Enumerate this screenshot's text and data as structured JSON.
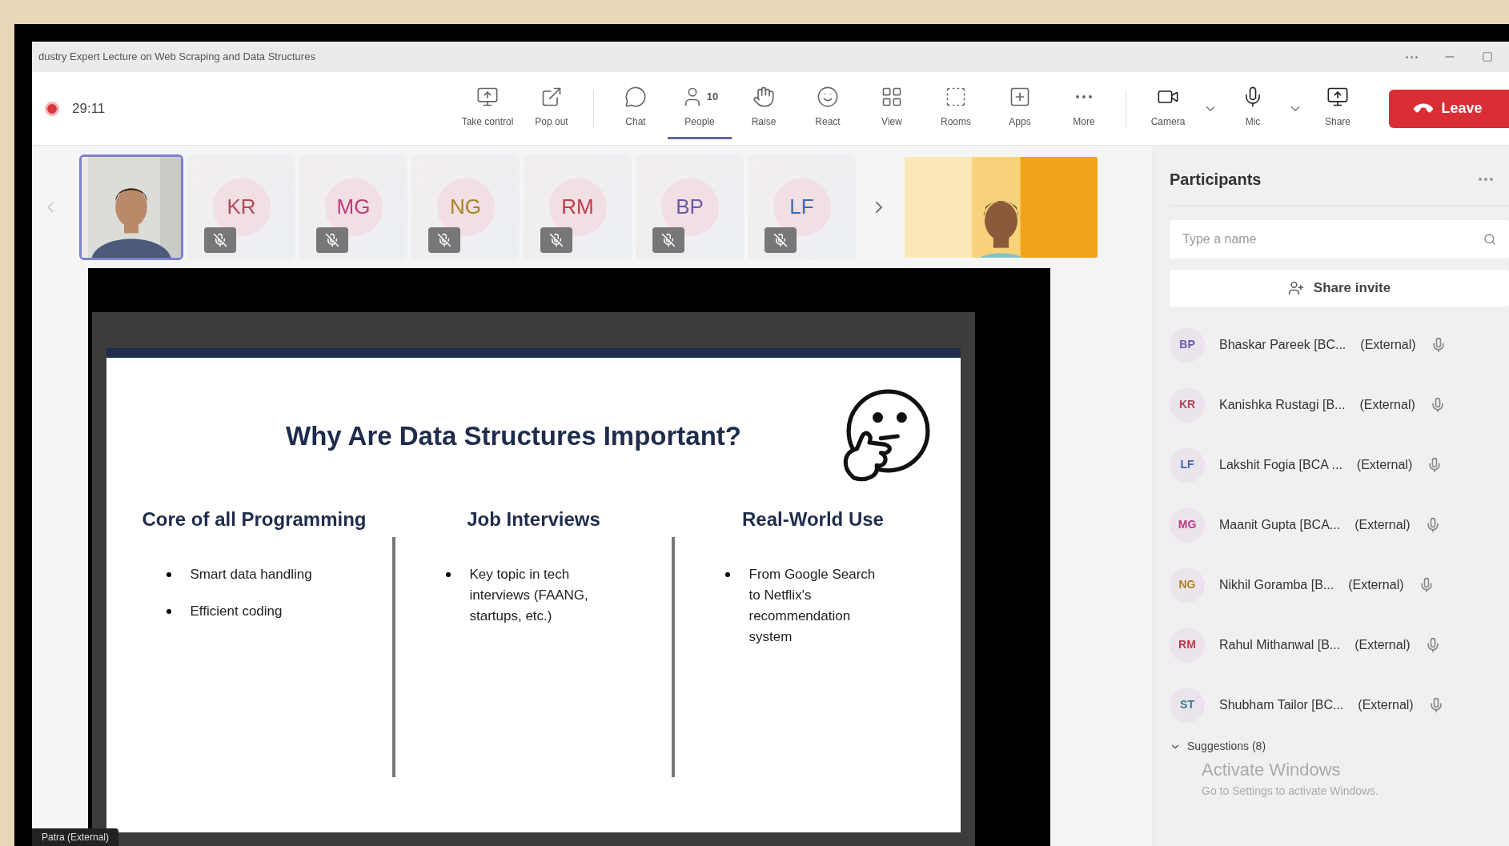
{
  "window": {
    "title": "dustry Expert Lecture on Web Scraping and Data Structures"
  },
  "toolbar": {
    "recording": true,
    "timer": "29:11",
    "items": [
      {
        "kind": "take-control",
        "label": "Take control",
        "selected": false
      },
      {
        "kind": "pop-out",
        "label": "Pop out",
        "selected": false
      },
      {
        "kind": "divider"
      },
      {
        "kind": "chat",
        "label": "Chat",
        "selected": false
      },
      {
        "kind": "people",
        "label": "People",
        "count": "10",
        "selected": true
      },
      {
        "kind": "raise",
        "label": "Raise",
        "selected": false
      },
      {
        "kind": "react",
        "label": "React",
        "selected": false
      },
      {
        "kind": "view",
        "label": "View",
        "selected": false
      },
      {
        "kind": "rooms",
        "label": "Rooms",
        "selected": false
      },
      {
        "kind": "apps",
        "label": "Apps",
        "selected": false
      },
      {
        "kind": "more",
        "label": "More",
        "selected": false
      },
      {
        "kind": "divider"
      },
      {
        "kind": "camera",
        "label": "Camera",
        "selected": false
      },
      {
        "kind": "mic",
        "label": "Mic",
        "selected": false
      },
      {
        "kind": "share",
        "label": "Share",
        "selected": false
      }
    ],
    "leave_button": "Leave"
  },
  "thumbnails": [
    {
      "kind": "video",
      "selected": true
    },
    {
      "kind": "avatar",
      "initials": "KR",
      "color": "#b04a5a",
      "muted": true,
      "selected": false
    },
    {
      "kind": "avatar",
      "initials": "MG",
      "color": "#c03a7a",
      "muted": true,
      "selected": false
    },
    {
      "kind": "avatar",
      "initials": "NG",
      "color": "#a88420",
      "muted": true,
      "selected": false
    },
    {
      "kind": "avatar",
      "initials": "RM",
      "color": "#c03a4a",
      "muted": true,
      "selected": false
    },
    {
      "kind": "avatar",
      "initials": "BP",
      "color": "#6a5aa8",
      "muted": true,
      "selected": false
    },
    {
      "kind": "avatar",
      "initials": "LF",
      "color": "#3a6ab0",
      "muted": true,
      "selected": false
    },
    {
      "kind": "next"
    },
    {
      "kind": "video",
      "selected": false
    }
  ],
  "slide": {
    "title": "Why Are Data Structures Important?",
    "columns": [
      {
        "heading": "Core of all Programming",
        "bullets": [
          "Smart data handling",
          "Efficient coding"
        ]
      },
      {
        "heading": "Job Interviews",
        "bullets": [
          "Key topic in tech interviews (FAANG, startups, etc.)"
        ]
      },
      {
        "heading": "Real-World Use",
        "bullets": [
          "From Google Search to Netflix's recommendation system"
        ]
      }
    ]
  },
  "presenter_tag": "Patra (External)",
  "participants_panel": {
    "title": "Participants",
    "search": {
      "placeholder": "Type a name"
    },
    "share_invite": "Share invite",
    "participants": [
      {
        "initials": "BP",
        "color": "#6a5aa8",
        "name": "Bhaskar Pareek [BC...",
        "tag": "(External)"
      },
      {
        "initials": "KR",
        "color": "#b04a5a",
        "name": "Kanishka Rustagi [B...",
        "tag": "(External)"
      },
      {
        "initials": "LF",
        "color": "#3a6ab0",
        "name": "Lakshit Fogia [BCA ...",
        "tag": "(External)"
      },
      {
        "initials": "MG",
        "color": "#c03a7a",
        "name": "Maanit Gupta [BCA...",
        "tag": "(External)"
      },
      {
        "initials": "NG",
        "color": "#a88420",
        "name": "Nikhil Goramba [B...",
        "tag": "(External)"
      },
      {
        "initials": "RM",
        "color": "#c03a4a",
        "name": "Rahul Mithanwal [B...",
        "tag": "(External)"
      },
      {
        "initials": "ST",
        "color": "#3a7890",
        "name": "Shubham Tailor [BC...",
        "tag": "(External)"
      }
    ],
    "suggestions": {
      "label": "Suggestions (8)",
      "expanded": true
    }
  },
  "activation_notice": {
    "title": "Activate Windows",
    "text": "Go to Settings to activate Windows."
  }
}
